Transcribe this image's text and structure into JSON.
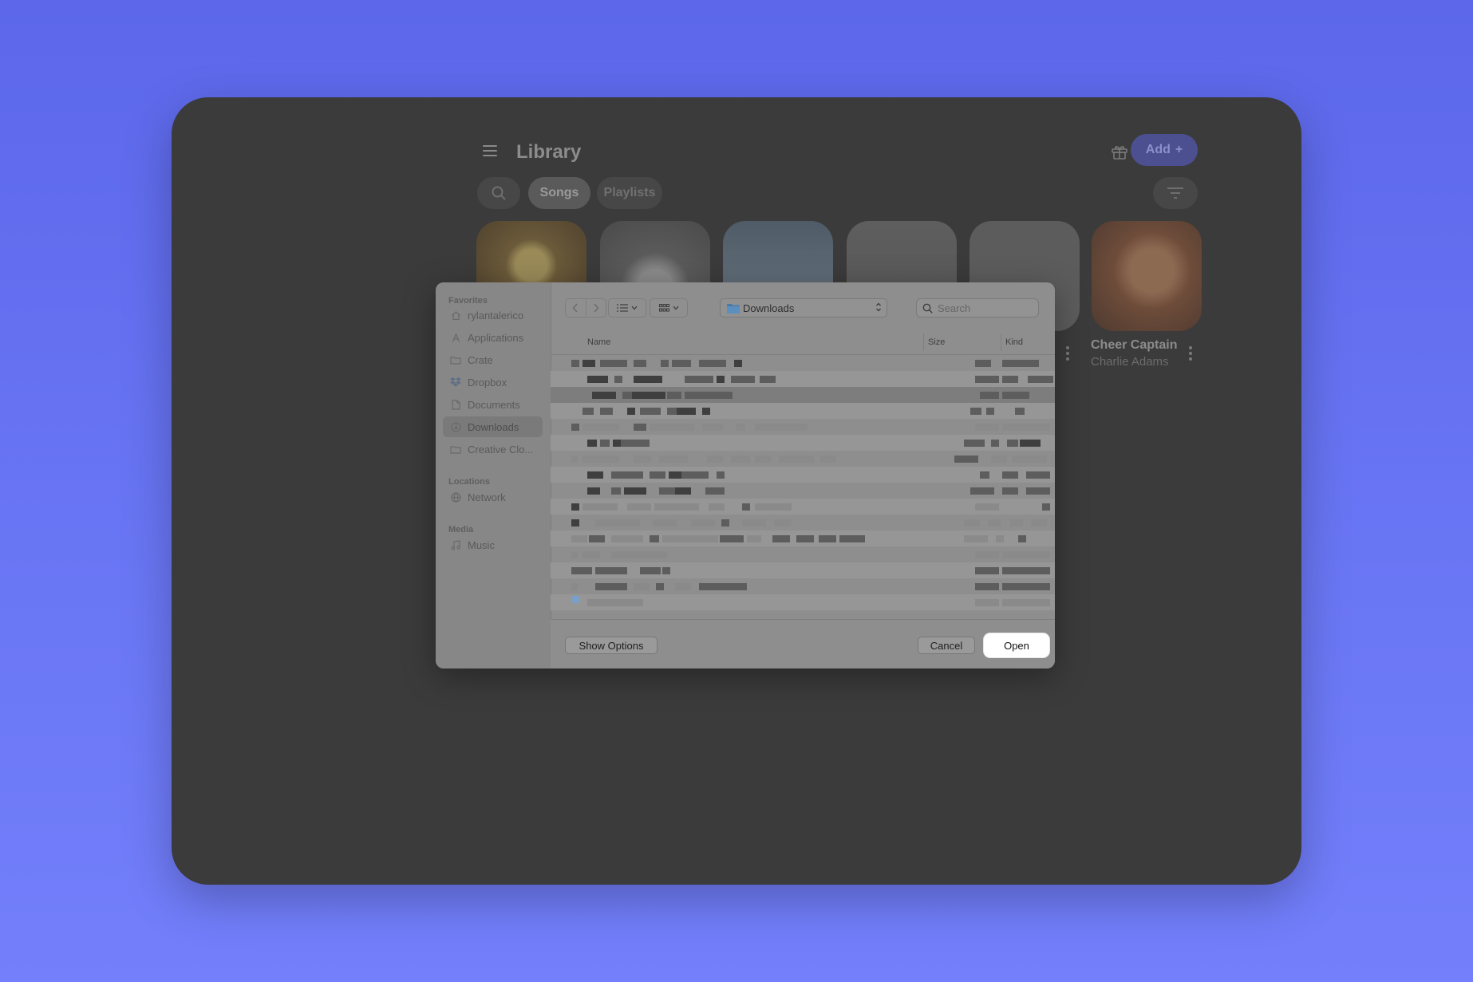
{
  "library": {
    "title": "Library",
    "add_label": "Add",
    "add_plus": "+",
    "tabs": [
      {
        "label": "Songs"
      },
      {
        "label": "Playlists"
      }
    ],
    "featured_album": {
      "title": "Cheer Captain",
      "artist": "Charlie Adams"
    }
  },
  "dialog": {
    "sidebar": {
      "sections": [
        {
          "heading": "Favorites",
          "items": [
            {
              "label": "rylantalerico",
              "icon": "home-icon"
            },
            {
              "label": "Applications",
              "icon": "applications-icon"
            },
            {
              "label": "Crate",
              "icon": "folder-icon"
            },
            {
              "label": "Dropbox",
              "icon": "dropbox-icon"
            },
            {
              "label": "Documents",
              "icon": "document-icon"
            },
            {
              "label": "Downloads",
              "icon": "downloads-icon",
              "selected": true
            },
            {
              "label": "Creative Clo...",
              "icon": "folder-icon"
            }
          ]
        },
        {
          "heading": "Locations",
          "items": [
            {
              "label": "Network",
              "icon": "network-icon"
            }
          ]
        },
        {
          "heading": "Media",
          "items": [
            {
              "label": "Music",
              "icon": "music-note-icon"
            }
          ]
        }
      ]
    },
    "toolbar": {
      "current_folder": "Downloads",
      "search_placeholder": "Search"
    },
    "columns": {
      "name": "Name",
      "size": "Size",
      "kind": "Kind"
    },
    "buttons": {
      "show_options": "Show Options",
      "cancel": "Cancel",
      "open": "Open"
    }
  }
}
